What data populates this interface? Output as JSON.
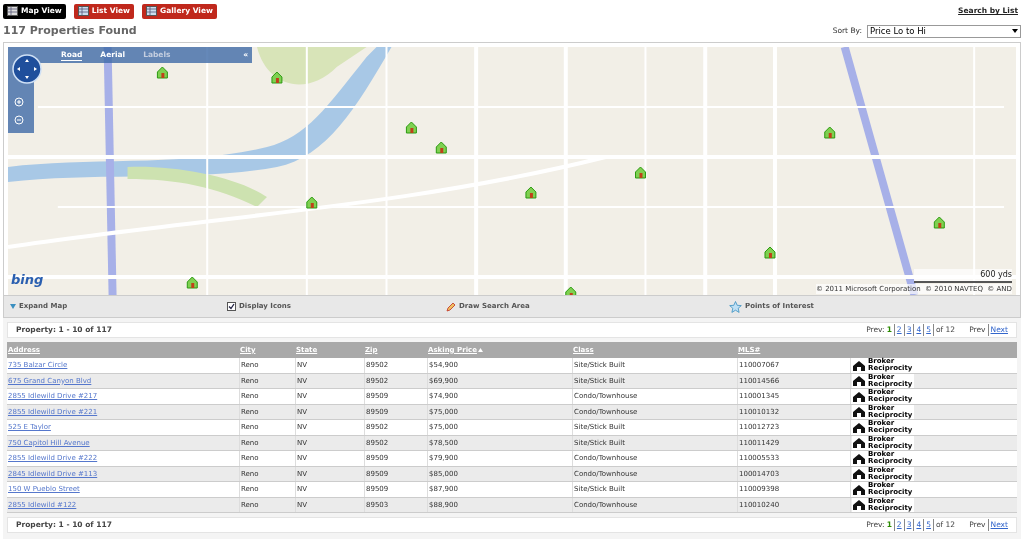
{
  "view_tabs": [
    {
      "label": "Map View",
      "selected": true
    },
    {
      "label": "List View",
      "selected": false
    },
    {
      "label": "Gallery View",
      "selected": false
    }
  ],
  "search_by_list": "Search by List",
  "heading": "117 Properties Found",
  "sort": {
    "label": "Sort By:",
    "value": "Price Lo to Hi"
  },
  "map": {
    "modes": [
      {
        "label": "Road",
        "selected": true,
        "disabled": false
      },
      {
        "label": "Aerial",
        "selected": false,
        "disabled": false
      },
      {
        "label": "Labels",
        "selected": false,
        "disabled": true
      }
    ],
    "collapse": "«",
    "logo": "bing",
    "scale": "600 yds",
    "copyright": "© 2011 Microsoft Corporation  © 2010 NAVTEQ  © AND"
  },
  "map_toolbar": [
    {
      "kind": "expand",
      "label": "Expand Map"
    },
    {
      "kind": "checkbox",
      "label": "Display Icons",
      "checked": true
    },
    {
      "kind": "draw",
      "label": "Draw Search Area"
    },
    {
      "kind": "poi",
      "label": "Points of Interest"
    }
  ],
  "pager": {
    "summary": "Property: 1 - 10 of 117",
    "prev_label": "Prev:",
    "pages": [
      {
        "label": "1",
        "selected": true
      },
      {
        "label": "2",
        "selected": false
      },
      {
        "label": "3",
        "selected": false
      },
      {
        "label": "4",
        "selected": false
      },
      {
        "label": "5",
        "selected": false
      }
    ],
    "of": "of 12",
    "prev": "Prev",
    "next": "Next"
  },
  "table": {
    "columns": [
      {
        "label": "Address",
        "sorted": false
      },
      {
        "label": "City",
        "sorted": false
      },
      {
        "label": "State",
        "sorted": false
      },
      {
        "label": "Zip",
        "sorted": false
      },
      {
        "label": "Asking Price",
        "sorted": true
      },
      {
        "label": "Class",
        "sorted": false
      },
      {
        "label": "MLS#",
        "sorted": false
      }
    ],
    "rows": [
      {
        "address": "735 Balzar Circle",
        "city": "Reno",
        "state": "NV",
        "zip": "89502",
        "price": "$54,900",
        "class": "Site/Stick Built",
        "mls": "110007067",
        "logo": [
          "Broker",
          "Reciprocity"
        ]
      },
      {
        "address": "675 Grand Canyon Blvd",
        "city": "Reno",
        "state": "NV",
        "zip": "89502",
        "price": "$69,900",
        "class": "Site/Stick Built",
        "mls": "110014566",
        "logo": [
          "Broker",
          "Reciprocity"
        ]
      },
      {
        "address": "2855 Idlewild Drive #217",
        "city": "Reno",
        "state": "NV",
        "zip": "89509",
        "price": "$74,900",
        "class": "Condo/Townhouse",
        "mls": "110001345",
        "logo": [
          "Broker",
          "Reciprocity"
        ]
      },
      {
        "address": "2855 Idlewild Drive #221",
        "city": "Reno",
        "state": "NV",
        "zip": "89509",
        "price": "$75,000",
        "class": "Condo/Townhouse",
        "mls": "110010132",
        "logo": [
          "Broker",
          "Reciprocity"
        ]
      },
      {
        "address": "525 E Taylor",
        "city": "Reno",
        "state": "NV",
        "zip": "89502",
        "price": "$75,000",
        "class": "Site/Stick Built",
        "mls": "110012723",
        "logo": [
          "Broker",
          "Reciprocity"
        ]
      },
      {
        "address": "750 Capitol Hill Avenue",
        "city": "Reno",
        "state": "NV",
        "zip": "89502",
        "price": "$78,500",
        "class": "Site/Stick Built",
        "mls": "110011429",
        "logo": [
          "Broker",
          "Reciprocity"
        ]
      },
      {
        "address": "2855 Idlewild Drive #222",
        "city": "Reno",
        "state": "NV",
        "zip": "89509",
        "price": "$79,900",
        "class": "Condo/Townhouse",
        "mls": "110005533",
        "logo": [
          "Broker",
          "Reciprocity"
        ]
      },
      {
        "address": "2845 Idlewild Drive #113",
        "city": "Reno",
        "state": "NV",
        "zip": "89509",
        "price": "$85,000",
        "class": "Condo/Townhouse",
        "mls": "100014703",
        "logo": [
          "Broker",
          "Reciprocity"
        ]
      },
      {
        "address": "150 W Pueblo Street",
        "city": "Reno",
        "state": "NV",
        "zip": "89509",
        "price": "$87,900",
        "class": "Site/Stick Built",
        "mls": "110009398",
        "logo": [
          "Broker",
          "Reciprocity"
        ]
      },
      {
        "address": "2855 Idlewild #122",
        "city": "Reno",
        "state": "NV",
        "zip": "89503",
        "price": "$88,900",
        "class": "Condo/Townhouse",
        "mls": "110010240",
        "logo": [
          "Broker",
          "Reciprocity"
        ]
      }
    ]
  },
  "pager_bottom": {
    "summary": "Property: 1 - 10 of 117",
    "prev_label": "Prev:",
    "pages": [
      {
        "label": "1",
        "selected": true
      },
      {
        "label": "2",
        "selected": false
      },
      {
        "label": "3",
        "selected": false
      },
      {
        "label": "4",
        "selected": false
      },
      {
        "label": "5",
        "selected": false
      }
    ],
    "of": "of 12",
    "prev": "Prev",
    "next": "Next"
  }
}
